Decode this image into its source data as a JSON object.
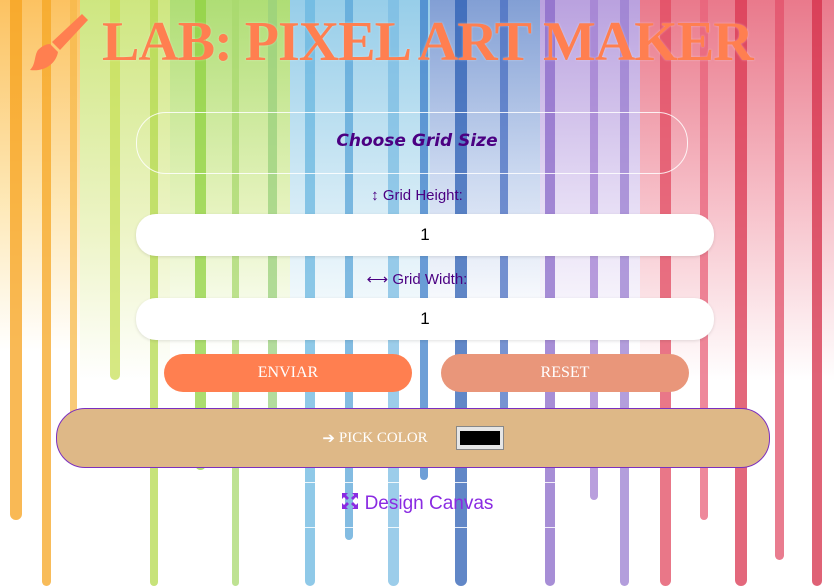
{
  "colors": {
    "title": "#ff7f50",
    "heading": "#4b0082",
    "submit": "#ff7f50",
    "reset": "#e9967a",
    "pick_bar": "#deb887",
    "swatch": "#000000",
    "canvas_title": "#8a2be2"
  },
  "header": {
    "title": "LAB: PIXEL ART MAKER",
    "icon": "paintbrush-icon"
  },
  "grid_form": {
    "heading": "Choose Grid Size",
    "height_label": "Grid Height:",
    "height_icon": "vertical-arrows-icon",
    "height_value": "1",
    "width_label": "Grid Width:",
    "width_icon": "horizontal-arrows-icon",
    "width_value": "1",
    "submit_label": "ENVIAR",
    "reset_label": "RESET"
  },
  "color_picker": {
    "label": "PICK COLOR",
    "icon": "arrow-right-icon",
    "value": "#000000"
  },
  "canvas": {
    "title": "Design Canvas",
    "icon": "expand-arrows-icon"
  }
}
